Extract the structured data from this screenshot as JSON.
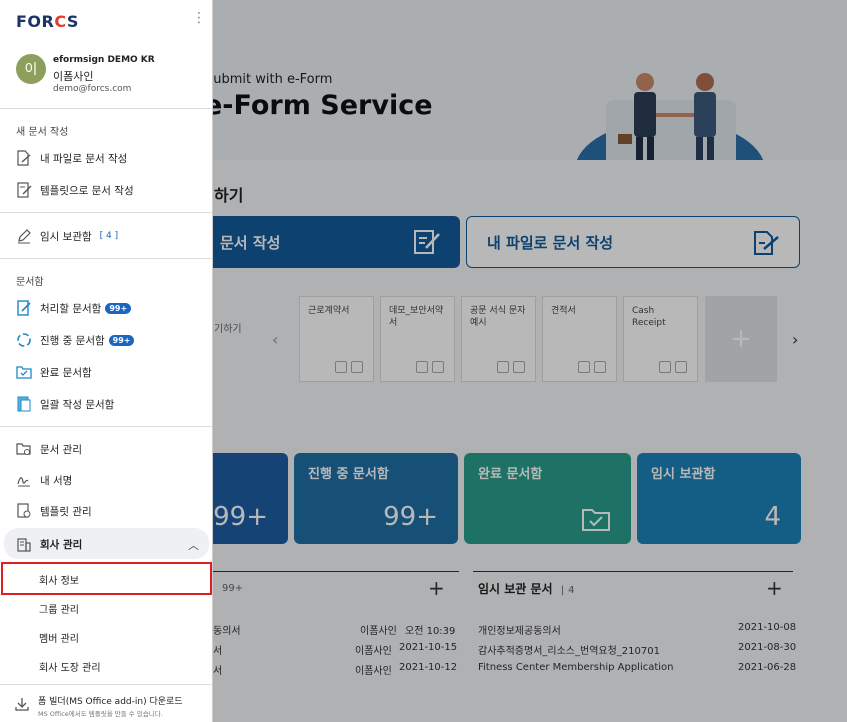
{
  "main": {
    "banner": {
      "subtitle": "Submit with e-Form",
      "title": "e-Form Service"
    },
    "section_title": "하기",
    "btn_template_label": "문서 작성",
    "btn_myfile_label": "내 파일로 문서 작성",
    "templates_label": "기하기",
    "templates": [
      {
        "name": "근로계약서"
      },
      {
        "name": "데모_보안서약서"
      },
      {
        "name": "공문 서식 문자예시"
      },
      {
        "name": "견적서"
      },
      {
        "name": "Cash Receipt"
      }
    ],
    "tiles": [
      {
        "name": "",
        "count": "99+"
      },
      {
        "name": "진행 중 문서함",
        "count": "99+"
      },
      {
        "name": "완료 문서함",
        "count": ""
      },
      {
        "name": "임시 보관함",
        "count": "4"
      }
    ],
    "list_left": {
      "count": "99+",
      "rows": [
        {
          "title": "동의서",
          "user": "이폼사인",
          "date": "오전 10:39"
        },
        {
          "title": "서",
          "user": "이폼사인",
          "date": "2021-10-15"
        },
        {
          "title": "서",
          "user": "이폼사인",
          "date": "2021-10-12"
        }
      ]
    },
    "list_right": {
      "title": "임시 보관 문서",
      "count": "4",
      "rows": [
        {
          "title": "개인정보제공동의서",
          "date": "2021-10-08"
        },
        {
          "title": "감사추적증명서_리소스_번역요청_210701",
          "date": "2021-08-30"
        },
        {
          "title": "Fitness Center Membership Application",
          "date": "2021-06-28"
        }
      ]
    }
  },
  "sidebar": {
    "logo": "FORCS",
    "account": {
      "avatar": "이",
      "company": "eformsign DEMO KR",
      "name": "이폼사인",
      "email": "demo@forcs.com"
    },
    "new_doc_label": "새 문서 작성",
    "new_doc_items": [
      "내 파일로 문서 작성",
      "템플릿으로 문서 작성"
    ],
    "drafts": {
      "label": "임시 보관함",
      "count": "[ 4 ]"
    },
    "inbox_label": "문서함",
    "inbox_items": [
      {
        "label": "처리할 문서함",
        "badge": "99+"
      },
      {
        "label": "진행 중 문서함",
        "badge": "99+"
      },
      {
        "label": "완료 문서함",
        "badge": ""
      },
      {
        "label": "일괄 작성 문서함",
        "badge": ""
      }
    ],
    "mgmt_items": [
      "문서 관리",
      "내 서명",
      "템플릿 관리"
    ],
    "company_mgmt": "회사 관리",
    "company_sub": [
      "회사 정보",
      "그룹 관리",
      "멤버 관리",
      "회사 도장 관리"
    ],
    "download": {
      "title": "폼 빌더(MS Office add-in) 다운로드",
      "sub": "MS Office에서도 템플릿을 만들 수 있습니다."
    }
  },
  "colors": {
    "primary": "#135c9c",
    "badge": "#1a66c3",
    "highlight": "#e02020"
  }
}
